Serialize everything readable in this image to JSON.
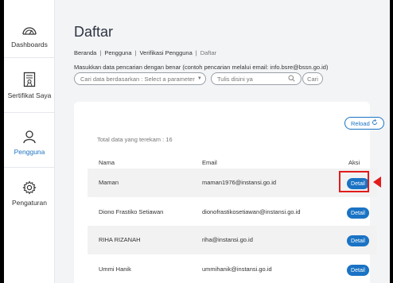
{
  "sidebar": {
    "items": [
      {
        "label": "Dashboards",
        "icon": "dashboard-gauge-icon"
      },
      {
        "label": "Sertifikat Saya",
        "icon": "certificate-icon"
      },
      {
        "label": "Pengguna",
        "icon": "user-icon",
        "active": true
      },
      {
        "label": "Pengaturan",
        "icon": "gear-icon"
      }
    ]
  },
  "header": {
    "title": "Daftar",
    "breadcrumb": [
      "Beranda",
      "Pengguna",
      "Verifikasi Pengguna",
      "Daftar"
    ],
    "hint": "Masukkan data pencarian dengan benar (contoh pencarian melalui email: info.bsre@bssn.go.id)"
  },
  "search": {
    "parameter_select": "Cari data berdasarkan : Select a parameter",
    "input_placeholder": "Tulis disini ya",
    "search_button": "Cari"
  },
  "table": {
    "reload_label": "Reload",
    "total_label": "Total data yang terekam : 16",
    "headers": {
      "name": "Nama",
      "email": "Email",
      "action": "Aksi"
    },
    "rows": [
      {
        "name": "Maman",
        "email": "maman1976@instansi.go.id",
        "action": "Detail"
      },
      {
        "name": "Diono Frastiko Setiawan",
        "email": "dionofrastikosetiawan@instansi.go.id",
        "action": "Detail"
      },
      {
        "name": "RIHA RIZANAH",
        "email": "riha@instansi.go.id",
        "action": "Detail"
      },
      {
        "name": "Ummi Hanik",
        "email": "ummihanik@instansi.go.id",
        "action": "Detail"
      }
    ]
  },
  "colors": {
    "accent": "#1a73c4",
    "highlight": "#e21b1b"
  }
}
